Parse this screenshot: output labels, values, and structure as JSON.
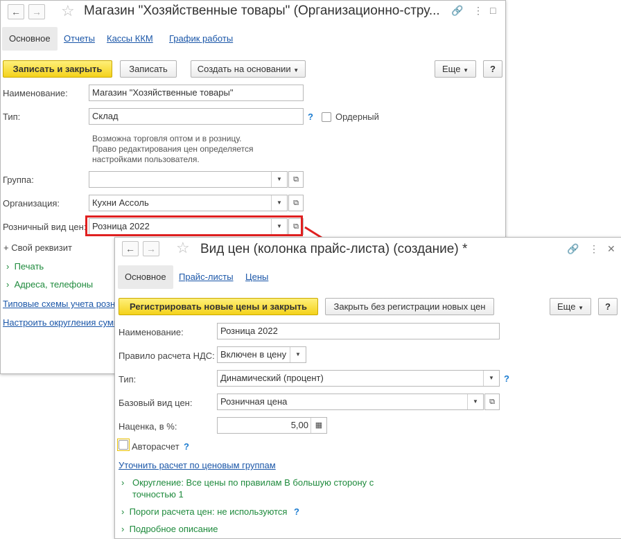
{
  "win1": {
    "title": "Магазин \"Хозяйственные товары\" (Организационно-стру...",
    "tabs": [
      "Основное",
      "Отчеты",
      "Кассы ККМ",
      "График работы"
    ],
    "buttons": {
      "save_close": "Записать и закрыть",
      "save": "Записать",
      "create_based": "Создать на основании",
      "more": "Еще",
      "help": "?"
    },
    "fields": {
      "name_label": "Наименование:",
      "name_value": "Магазин \"Хозяйственные товары\"",
      "type_label": "Тип:",
      "type_value": "Склад",
      "order_label": "Ордерный",
      "note": [
        "Возможна торговля оптом и в розницу.",
        "Право редактирования цен определяется",
        "настройками пользователя."
      ],
      "group_label": "Группа:",
      "group_value": "",
      "org_label": "Организация:",
      "org_value": "Кухни Ассоль",
      "retail_label": "Розничный вид цен:",
      "retail_value": "Розница 2022"
    },
    "extra": {
      "custom_attr": "+ Свой реквизит",
      "print": "Печать",
      "addresses": "Адреса, телефоны",
      "schemes": "Типовые схемы учета розн",
      "rounding": "Настроить округления сумм"
    }
  },
  "win2": {
    "title": "Вид цен (колонка прайс-листа) (создание) *",
    "tabs": [
      "Основное",
      "Прайс-листы",
      "Цены"
    ],
    "buttons": {
      "register_close": "Регистрировать новые цены и закрыть",
      "close_no_reg": "Закрыть без регистрации новых цен",
      "more": "Еще",
      "help": "?"
    },
    "fields": {
      "name_label": "Наименование:",
      "name_value": "Розница 2022",
      "vat_label": "Правило расчета НДС:",
      "vat_value": "Включен в цену",
      "type_label": "Тип:",
      "type_value": "Динамический (процент)",
      "base_label": "Базовый вид цен:",
      "base_value": "Розничная цена",
      "markup_label": "Наценка, в %:",
      "markup_value": "5,00",
      "auto_label": "Авторасчет"
    },
    "links": {
      "refine": "Уточнить расчет по ценовым группам",
      "rounding_line1": "Округление: Все цены по правилам В большую сторону с",
      "rounding_line2": "точностью 1",
      "thresholds": "Пороги расчета цен: не используются",
      "description": "Подробное описание"
    }
  },
  "colors": {
    "highlight": "#e02020",
    "accent_yellow": "#f4d21b",
    "link": "#1a56a8",
    "green": "#1e8a3c"
  }
}
